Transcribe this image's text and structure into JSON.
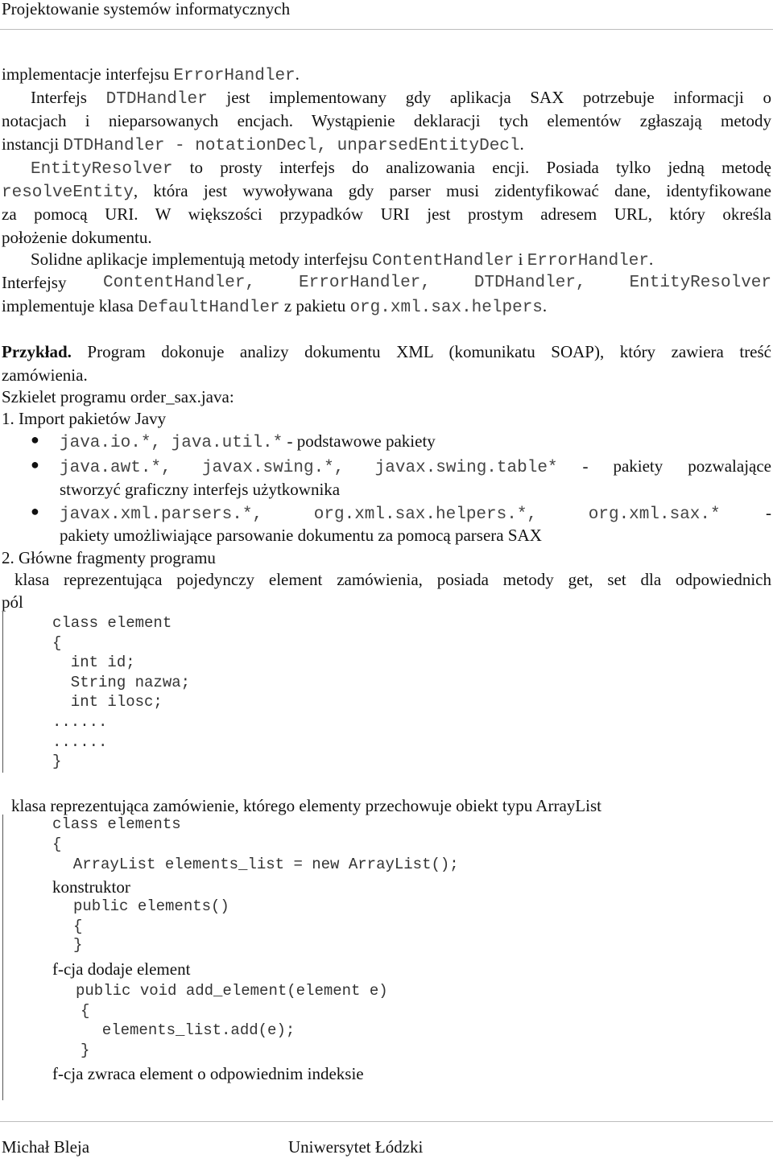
{
  "header": {
    "title": "Projektowanie systemów informatycznych"
  },
  "para0": {
    "t1": "implementacje interfejsu ",
    "c1": "ErrorHandler",
    "t2": "."
  },
  "para1": {
    "l1a": "Interfejs ",
    "l1c": "DTDHandler",
    "l1b": " jest implementowany gdy aplikacja SAX potrzebuje informacji o",
    "l2": "notacjach i nieparsowanych encjach. Wystąpienie deklaracji tych elementów zgłaszają metody",
    "l3a": "instancji ",
    "l3c": "DTDHandler - notationDecl, unparsedEntityDecl",
    "l3b": "."
  },
  "para2": {
    "l1c": "EntityResolver",
    "l1b": " to prosty interfejs do analizowania encji. Posiada tylko jedną metodę",
    "l2c": "resolveEntity",
    "l2b": ", która jest wywoływana gdy parser musi zidentyfikować dane, identyfikowane",
    "l3": "za pomocą URI. W większości przypadków URI jest prostym adresem URL, który określa",
    "l4": "położenie dokumentu."
  },
  "para3": {
    "l1a": "Solidne aplikacje implementują metody interfejsu ",
    "l1c1": "ContentHandler",
    "l1b": " i ",
    "l1c2": "ErrorHandler",
    "l1d": ".",
    "l2a": "Interfejsy",
    "l2c": "ContentHandler, ErrorHandler, DTDHandler, EntityResolver",
    "l3a": "implementuje klasa ",
    "l3c1": "DefaultHandler",
    "l3b": " z pakietu ",
    "l3c2": "org.xml.sax.helpers",
    "l3d": "."
  },
  "example": {
    "label": "Przykład.",
    "l1": " Program dokonuje analizy dokumentu XML (komunikatu SOAP), który zawiera treść",
    "l2": "zamówienia.",
    "l3": "Szkielet programu order_sax.java:"
  },
  "list": {
    "item1": "1.  Import pakietów Javy",
    "b1c": "java.io.*, java.util.*",
    "b1t": " - podstawowe pakiety",
    "b2c": "java.awt.*, javax.swing.*, javax.swing.table*",
    "b2t": " - pakiety pozwalające",
    "b2l2": "stworzyć graficzny interfejs użytkownika",
    "b3c": "javax.xml.parsers.*,  org.xml.sax.helpers.*,  org.xml.sax.*",
    "b3t": " -",
    "b3l2": "pakiety umożliwiające parsowanie dokumentu za pomocą parsera SAX",
    "item2": "2.  Główne fragmenty programu"
  },
  "block1": {
    "desc1": "klasa reprezentująca pojedynczy element zamówienia, posiada metody get, set dla odpowiednich",
    "desc2": "pól",
    "code": [
      "class element",
      "{",
      "  int id;",
      "  String nazwa;",
      "  int ilosc;",
      "......",
      "......",
      "}"
    ]
  },
  "block2": {
    "desc": "klasa reprezentująca zamówienie, którego elementy przechowuje obiekt typu ArrayList",
    "c1": "class elements",
    "c2": "{",
    "c3": "  ArrayList elements_list = new ArrayList();",
    "lbl1": "konstruktor",
    "c4": "public elements()",
    "c5": "{",
    "c6": "}",
    "lbl2": "f-cja dodaje element",
    "c7": "public void add_element(element e)",
    "c8": "{",
    "c9": "  elements_list.add(e);",
    "c10": "}",
    "lbl3": "f-cja zwraca element o odpowiednim indeksie"
  },
  "footer": {
    "author": "Michał Bleja",
    "university": "Uniwersytet Łódzki"
  }
}
